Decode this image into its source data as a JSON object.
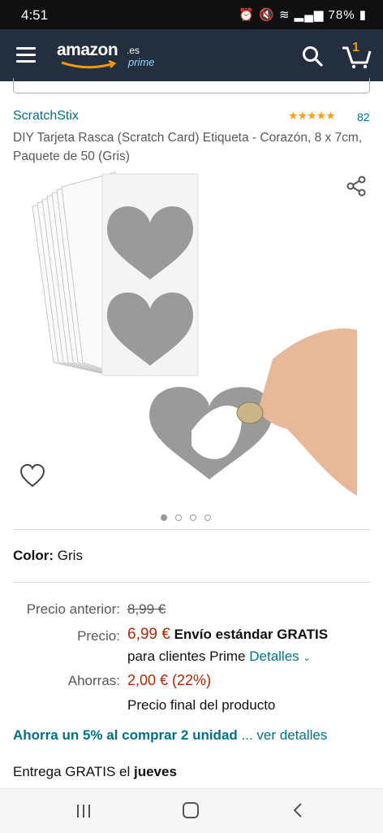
{
  "status": {
    "time": "4:51",
    "battery": "78%",
    "icons": "alarm, mute, wifi, signal"
  },
  "appbar": {
    "logo_word": "amazon",
    "logo_tld": ".es",
    "logo_sub": "prime",
    "cart_count": "1",
    "icons": [
      "menu-icon",
      "search-icon",
      "cart-icon"
    ]
  },
  "product": {
    "brand": "ScratchStix",
    "stars": "★★★★★",
    "rating_count": "82",
    "title": "DIY Tarjeta Rasca (Scratch Card) Etiqueta - Corazón, 8 x 7cm, Paquete de 50 (Gris)",
    "image_count": 4,
    "active_image": 0
  },
  "color": {
    "label": "Color:",
    "value": "Gris"
  },
  "pricing": {
    "previous_label": "Precio anterior:",
    "previous_value": "8,99 €",
    "price_label": "Precio:",
    "price_value": "6,99 €",
    "shipping": "Envío estándar GRATIS",
    "prime_line": "para clientes Prime",
    "details_link": "Detalles",
    "savings_label": "Ahorras:",
    "savings_value": "2,00 € (22%)",
    "final_note": "Precio final del producto"
  },
  "promo": {
    "text": "Ahorra un 5% al comprar 2 unidad",
    "link": "... ver detalles"
  },
  "delivery": {
    "prefix": "Entrega GRATIS el",
    "day": "jueves"
  },
  "colors": {
    "appbar": "#232f3e",
    "link": "#007185",
    "price": "#b12704",
    "stars": "#f0a41d"
  }
}
